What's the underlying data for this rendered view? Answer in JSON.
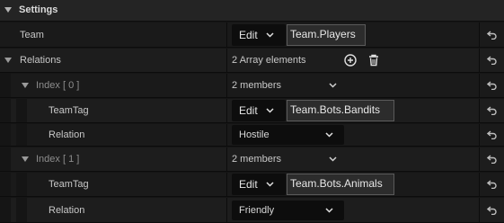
{
  "section": {
    "title": "Settings"
  },
  "team": {
    "label": "Team",
    "edit_label": "Edit",
    "value": "Team.Players"
  },
  "relations": {
    "label": "Relations",
    "count_text": "2 Array elements",
    "add_icon": "plus-circle-icon",
    "delete_icon": "trash-icon",
    "elements": [
      {
        "label": "Index [ 0 ]",
        "members_text": "2 members",
        "teamtag_label": "TeamTag",
        "teamtag_edit": "Edit",
        "teamtag_value": "Team.Bots.Bandits",
        "relation_label": "Relation",
        "relation_value": "Hostile"
      },
      {
        "label": "Index [ 1 ]",
        "members_text": "2 members",
        "teamtag_label": "TeamTag",
        "teamtag_edit": "Edit",
        "teamtag_value": "Team.Bots.Animals",
        "relation_label": "Relation",
        "relation_value": "Friendly"
      }
    ]
  },
  "reset_icon": "reset-to-default-icon"
}
